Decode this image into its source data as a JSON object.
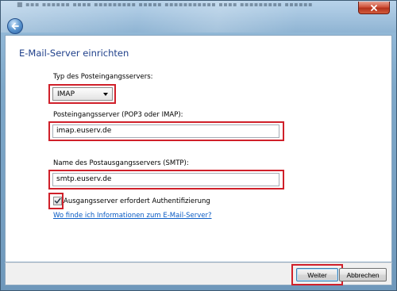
{
  "window": {
    "background_text": "■ ▪▪▪ ▪▪▪▪▪▪ ▪▪▪▪ ▪▪▪▪▪▪▪▪▪ ▪▪▪▪▪ ▪▪▪▪▪▪▪▪▪▪▪ ▪▪▪▪ ▪▪▪▪▪▪▪▪▪ ▪▪▪▪▪▪",
    "close_icon": "close-icon",
    "back_icon": "back-arrow-icon"
  },
  "page": {
    "title": "E-Mail-Server einrichten"
  },
  "form": {
    "incoming_type_label": "Typ des Posteingangsservers:",
    "incoming_type_value": "IMAP",
    "incoming_server_label": "Posteingangsserver (POP3 oder IMAP):",
    "incoming_server_value": "imap.euserv.de",
    "outgoing_server_label": "Name des Postausgangsservers (SMTP):",
    "outgoing_server_value": "smtp.euserv.de",
    "auth_checkbox_label": "Ausgangsserver erfordert Authentifizierung",
    "auth_checked": true,
    "help_link": "Wo finde ich Informationen zum E-Mail-Server?"
  },
  "buttons": {
    "next": "Weiter",
    "cancel": "Abbrechen"
  },
  "colors": {
    "highlight": "#d0202a",
    "title_blue": "#1e3f8a",
    "link_blue": "#0a5bc4"
  }
}
